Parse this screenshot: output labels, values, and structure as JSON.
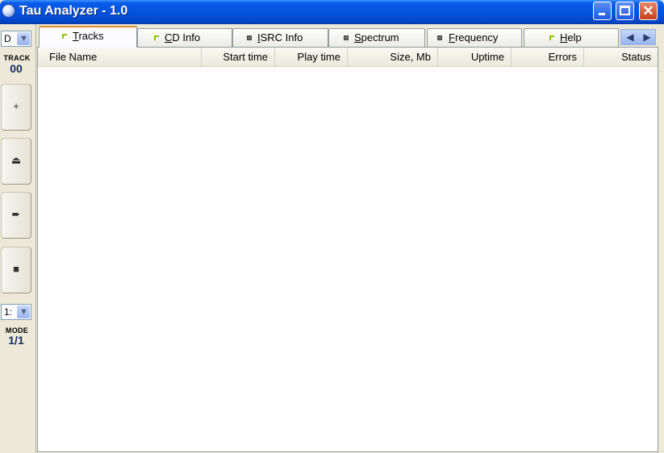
{
  "window": {
    "title": "Tau Analyzer - 1.0",
    "minimize": "minimize",
    "maximize": "maximize",
    "close": "✕"
  },
  "left_panel": {
    "drive_value": "D",
    "track_label": "TRACK",
    "track_value": "00",
    "buttons": [
      {
        "name": "add",
        "glyph": "+"
      },
      {
        "name": "eject",
        "glyph": "⏏"
      },
      {
        "name": "next",
        "glyph": "➨"
      },
      {
        "name": "stop",
        "glyph": "■"
      }
    ],
    "mode_value": "1:",
    "mode_label": "MODE",
    "mode_readout": "1/1"
  },
  "tabs": [
    {
      "label": "Tracks",
      "accel": "T",
      "rest": "racks",
      "active": true,
      "icon": "green"
    },
    {
      "label": "CD Info",
      "accel": "C",
      "rest": "D Info",
      "active": false,
      "icon": "green"
    },
    {
      "label": "ISRC Info",
      "accel": "I",
      "rest": "SRC Info",
      "active": false,
      "icon": "gray"
    },
    {
      "label": "Spectrum",
      "accel": "S",
      "rest": "pectrum",
      "active": false,
      "icon": "gray"
    },
    {
      "label": "Frequency",
      "accel": "F",
      "rest": "requency",
      "active": false,
      "icon": "gray"
    },
    {
      "label": "Help",
      "accel": "H",
      "rest": "elp",
      "active": false,
      "icon": "green"
    }
  ],
  "tab_scroll": {
    "left": "◀",
    "right": "▶"
  },
  "table": {
    "columns": [
      "File Name",
      "Start time",
      "Play time",
      "Size, Mb",
      "Uptime",
      "Errors",
      "Status"
    ],
    "rows": []
  },
  "colors": {
    "titlebar": "#0553e0",
    "active_tab_accent": "#e68b2c",
    "tab_icon_green": "#8fc400"
  }
}
